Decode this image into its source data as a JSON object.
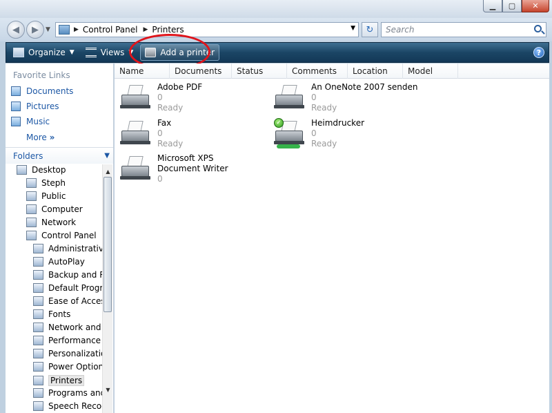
{
  "address_bar": {
    "breadcrumbs": [
      "Control Panel",
      "Printers"
    ],
    "search_placeholder": "Search"
  },
  "toolbar": {
    "organize": "Organize",
    "views": "Views",
    "add_printer": "Add a printer"
  },
  "nav": {
    "favorites_header": "Favorite Links",
    "favorites": [
      "Documents",
      "Pictures",
      "Music"
    ],
    "more": "More",
    "more_glyph": "»",
    "folders_header": "Folders",
    "tree": [
      "Desktop",
      "Steph",
      "Public",
      "Computer",
      "Network",
      "Control Panel",
      "Administrative",
      "AutoPlay",
      "Backup and Re",
      "Default Progra",
      "Ease of Access",
      "Fonts",
      "Network and S",
      "Performance Ir",
      "Personalizatio",
      "Power Options",
      "Printers",
      "Programs and",
      "Speech Recog"
    ],
    "selected": "Printers"
  },
  "columns": [
    "Name",
    "Documents",
    "Status",
    "Comments",
    "Location",
    "Model"
  ],
  "printers": [
    {
      "name": "Adobe PDF",
      "docs": "0",
      "status": "Ready",
      "icon": "printer-icon"
    },
    {
      "name": "An OneNote 2007 senden",
      "docs": "0",
      "status": "Ready",
      "icon": "printer-icon"
    },
    {
      "name": "Fax",
      "docs": "0",
      "status": "Ready",
      "icon": "fax-icon"
    },
    {
      "name": "Heimdrucker",
      "docs": "0",
      "status": "Ready",
      "icon": "default-network-printer-icon"
    },
    {
      "name": "Microsoft XPS Document Writer",
      "docs": "0",
      "status": "",
      "icon": "printer-icon"
    }
  ],
  "colors": {
    "toolbar_dark": "#133857",
    "link_blue": "#1c57a5",
    "highlight_circle": "#e0141b"
  }
}
